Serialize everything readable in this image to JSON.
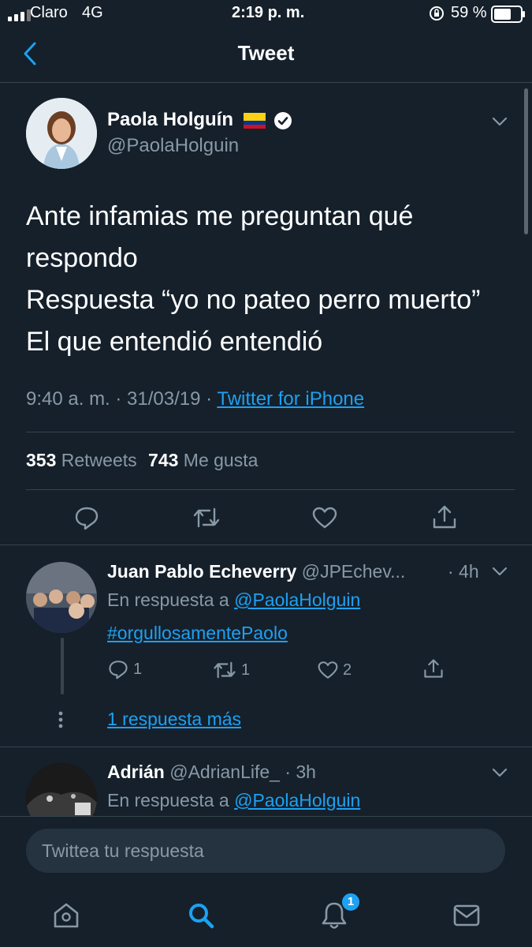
{
  "status_bar": {
    "carrier": "Claro",
    "network": "4G",
    "time": "2:19 p. m.",
    "battery": "59 %"
  },
  "header": {
    "title": "Tweet",
    "back_icon": "chevron-left-icon"
  },
  "tweet": {
    "author_name": "Paola Holguín",
    "handle": "@PaolaHolguin",
    "lines": [
      "Ante infamias me preguntan qué",
      "respondo",
      "Respuesta “yo no pateo perro muerto”",
      "El que entendió entendió"
    ],
    "meta": "9:40 a. m. · 31/03/19 · ",
    "source": "Twitter for iPhone",
    "retweets_count": "353",
    "retweets_label": "Retweets",
    "likes_count": "743",
    "likes_label": "Me gusta"
  },
  "replies": [
    {
      "name": "Juan Pablo Echeverry",
      "handle": "@JPEchev...",
      "time": "· 4h",
      "reply_prefix": "En respuesta a ",
      "reply_to": "@PaolaHolguin",
      "text": "#orgullosamentePaolo",
      "reply_count": "1",
      "retweet_count": "1",
      "like_count": "2",
      "more_replies": "1 respuesta más"
    },
    {
      "name": "Adrián",
      "handle": "@AdrianLife_",
      "time": "· 3h",
      "reply_prefix": "En respuesta a ",
      "reply_to": "@PaolaHolguin"
    }
  ],
  "compose": {
    "placeholder": "Twittea tu respuesta"
  },
  "tab_bar": {
    "notifications_badge": "1"
  },
  "colors": {
    "background": "#15202b",
    "accent": "#1da1f2",
    "muted": "#8899a6",
    "divider": "#38444d"
  }
}
